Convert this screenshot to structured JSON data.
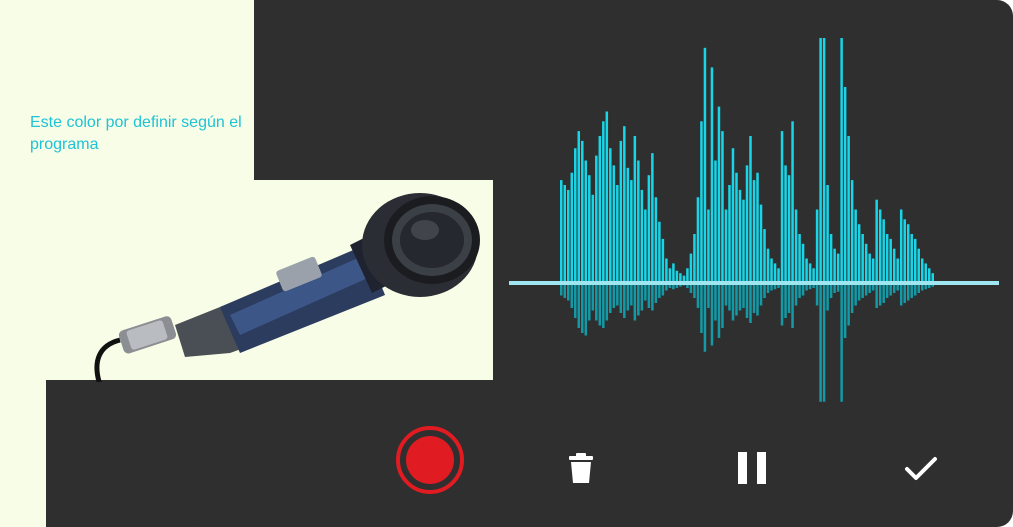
{
  "note": {
    "text": "Este color por definir según el programa",
    "background_color": "#f8fde7",
    "text_color": "#1ec3d6"
  },
  "recorder": {
    "background_color": "#2f2f2f",
    "waveform_color": "#18d6e8",
    "baseline_color": "#9fe6f0",
    "record_color": "#e01b22"
  },
  "controls": {
    "record": {
      "icon": "record-icon"
    },
    "delete": {
      "icon": "trash-icon"
    },
    "pause": {
      "icon": "pause-icon"
    },
    "confirm": {
      "icon": "check-icon"
    }
  },
  "waveform": {
    "levels_up": [
      0.42,
      0.4,
      0.38,
      0.45,
      0.55,
      0.62,
      0.58,
      0.5,
      0.44,
      0.36,
      0.52,
      0.6,
      0.66,
      0.7,
      0.55,
      0.48,
      0.4,
      0.58,
      0.64,
      0.47,
      0.42,
      0.6,
      0.5,
      0.38,
      0.3,
      0.44,
      0.53,
      0.35,
      0.25,
      0.18,
      0.1,
      0.06,
      0.08,
      0.05,
      0.04,
      0.03,
      0.06,
      0.12,
      0.2,
      0.35,
      0.66,
      0.96,
      0.3,
      0.88,
      0.5,
      0.72,
      0.62,
      0.3,
      0.4,
      0.55,
      0.45,
      0.38,
      0.34,
      0.48,
      0.6,
      0.42,
      0.45,
      0.32,
      0.22,
      0.14,
      0.1,
      0.08,
      0.06,
      0.62,
      0.48,
      0.44,
      0.66,
      0.3,
      0.2,
      0.16,
      0.1,
      0.08,
      0.06,
      0.3,
      1.0,
      1.0,
      0.4,
      0.2,
      0.14,
      0.12,
      1.0,
      0.8,
      0.6,
      0.42,
      0.3,
      0.24,
      0.2,
      0.16,
      0.12,
      0.1,
      0.34,
      0.3,
      0.26,
      0.2,
      0.18,
      0.14,
      0.1,
      0.3,
      0.26,
      0.24,
      0.2,
      0.18,
      0.14,
      0.1,
      0.08,
      0.06,
      0.04
    ],
    "levels_down": [
      0.1,
      0.12,
      0.14,
      0.2,
      0.28,
      0.36,
      0.4,
      0.42,
      0.3,
      0.22,
      0.3,
      0.34,
      0.36,
      0.3,
      0.24,
      0.2,
      0.18,
      0.24,
      0.28,
      0.22,
      0.18,
      0.3,
      0.26,
      0.22,
      0.14,
      0.2,
      0.22,
      0.16,
      0.12,
      0.1,
      0.06,
      0.04,
      0.05,
      0.04,
      0.03,
      0.02,
      0.04,
      0.08,
      0.12,
      0.2,
      0.4,
      0.55,
      0.2,
      0.5,
      0.3,
      0.44,
      0.36,
      0.18,
      0.22,
      0.3,
      0.26,
      0.22,
      0.2,
      0.28,
      0.32,
      0.24,
      0.26,
      0.18,
      0.12,
      0.08,
      0.06,
      0.05,
      0.04,
      0.34,
      0.28,
      0.24,
      0.36,
      0.18,
      0.12,
      0.1,
      0.06,
      0.05,
      0.04,
      0.18,
      0.95,
      0.95,
      0.22,
      0.12,
      0.08,
      0.07,
      0.95,
      0.44,
      0.34,
      0.24,
      0.18,
      0.14,
      0.12,
      0.1,
      0.08,
      0.06,
      0.2,
      0.18,
      0.16,
      0.12,
      0.1,
      0.08,
      0.06,
      0.18,
      0.16,
      0.14,
      0.12,
      0.1,
      0.08,
      0.06,
      0.05,
      0.04,
      0.03
    ]
  }
}
